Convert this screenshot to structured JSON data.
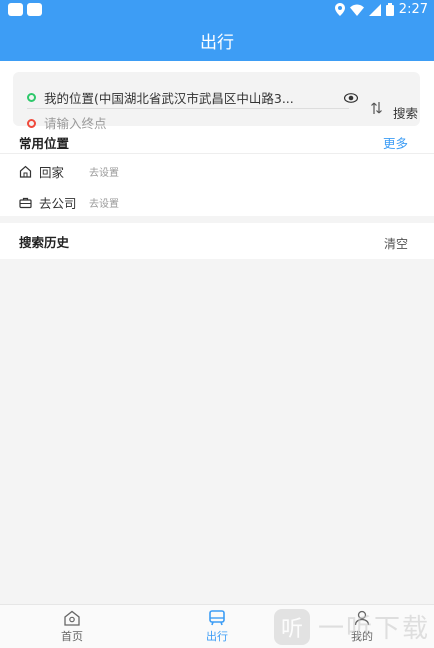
{
  "status_bar": {
    "time": "2:27"
  },
  "header": {
    "title": "出行"
  },
  "search": {
    "start_text": "我的位置(中国湖北省武汉市武昌区中山路3...",
    "end_placeholder": "请输入终点",
    "search_label": "搜索"
  },
  "common_places": {
    "title": "常用位置",
    "more_label": "更多",
    "items": [
      {
        "name": "回家",
        "hint": "去设置",
        "icon": "home-icon"
      },
      {
        "name": "去公司",
        "hint": "去设置",
        "icon": "briefcase-icon"
      }
    ]
  },
  "history": {
    "title": "搜索历史",
    "clear_label": "清空"
  },
  "tabs": [
    {
      "label": "首页",
      "icon": "home-tab-icon"
    },
    {
      "label": "出行",
      "icon": "bus-icon"
    },
    {
      "label": "我的",
      "icon": "user-icon"
    }
  ],
  "watermark": {
    "badge": "听",
    "text": "一听下载"
  },
  "colors": {
    "primary": "#3d9df5",
    "start_dot": "#2ec86b",
    "end_dot": "#f04a3c"
  }
}
